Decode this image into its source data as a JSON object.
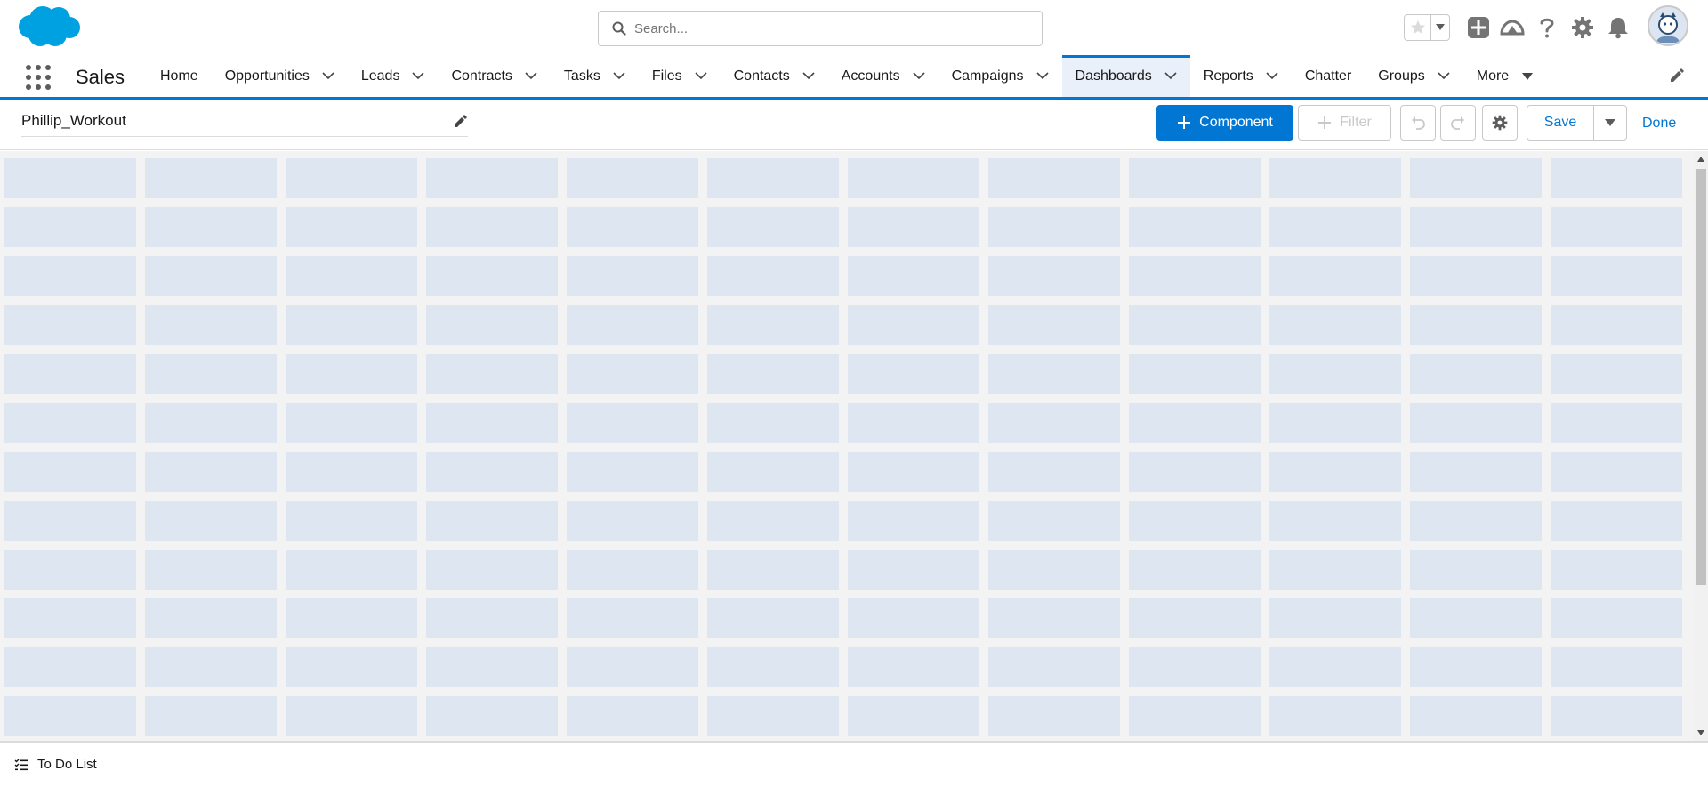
{
  "header": {
    "search_placeholder": "Search..."
  },
  "nav": {
    "app_name": "Sales",
    "items": [
      {
        "label": "Home",
        "has_menu": false
      },
      {
        "label": "Opportunities",
        "has_menu": true
      },
      {
        "label": "Leads",
        "has_menu": true
      },
      {
        "label": "Contracts",
        "has_menu": true
      },
      {
        "label": "Tasks",
        "has_menu": true
      },
      {
        "label": "Files",
        "has_menu": true
      },
      {
        "label": "Contacts",
        "has_menu": true
      },
      {
        "label": "Accounts",
        "has_menu": true
      },
      {
        "label": "Campaigns",
        "has_menu": true
      },
      {
        "label": "Dashboards",
        "has_menu": true,
        "active": true
      },
      {
        "label": "Reports",
        "has_menu": true
      },
      {
        "label": "Chatter",
        "has_menu": false
      },
      {
        "label": "Groups",
        "has_menu": true
      },
      {
        "label": "More",
        "has_menu": true,
        "caret": true
      }
    ]
  },
  "dashboard": {
    "title": "Phillip_Workout",
    "component_label": "Component",
    "filter_label": "Filter",
    "save_label": "Save",
    "done_label": "Done",
    "grid": {
      "columns": 12,
      "rows": 12
    }
  },
  "utility_bar": {
    "todo_label": "To Do List"
  },
  "colors": {
    "brand_blue": "#0176d3",
    "grid_cell": "#dee7f1",
    "canvas_bg": "#f3f3f3"
  }
}
